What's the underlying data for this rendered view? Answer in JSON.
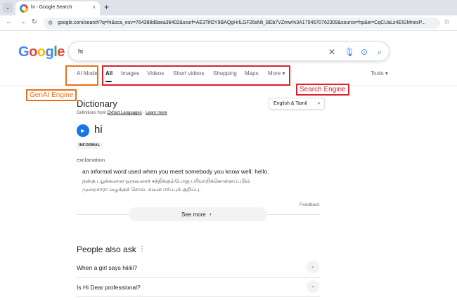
{
  "browser": {
    "tab_menu_icon": "chevron-down-icon",
    "tab_title": "hi - Google Search",
    "tab_close": "×",
    "new_tab": "+",
    "back": "←",
    "forward": "→",
    "reload": "↻",
    "site_info_icon": "tune-icon",
    "url": "google.com/search?q=hi&sca_esv=764388d8aea36402&sxsrf=AE3TifOY9BAQgHrlLGF26sNli_BEb7VZmw%3A1754570762309&source=hp&ei=CqCUaLz4EIGMnesP...",
    "star": "☆"
  },
  "google": {
    "logo_letters": [
      "G",
      "o",
      "o",
      "g",
      "l",
      "e"
    ],
    "query": "hi",
    "clear_icon": "✕",
    "mic_icon": "🎙",
    "lens_icon": "⊙",
    "search_icon": "⌕"
  },
  "tabs": {
    "ai_mode": "AI Mode",
    "all": "All",
    "images": "Images",
    "videos": "Videos",
    "short_videos": "Short videos",
    "shopping": "Shopping",
    "maps": "Maps",
    "more": "More ▾",
    "tools": "Tools ▾"
  },
  "annotations": {
    "genai_label": "GenAI Engine",
    "search_label": "Search Engine",
    "orange": "#e8711a",
    "red": "#d9232e"
  },
  "dictionary": {
    "title": "Dictionary",
    "source_prefix": "Definitions from ",
    "source_link": "Oxford Languages",
    "source_sep": " · ",
    "learn_more": "Learn more",
    "language": "English & Tamil",
    "language_caret": "▾",
    "speaker_icon": "🔊",
    "word": "hi",
    "register": "INFORMAL",
    "part_of_speech": "exclamation",
    "definition": "an informal word used when you meet somebody you know well; hello.",
    "tamil_line1": "நன்கு பழக்கமான ஒருவரைச் சந்திக்கும்போது பரிமாறிக்கொள்ளப்படும்",
    "tamil_line2": "முறைசாரா வழக்குச் சொல். கவன ஈர்ப்புக் குறிப்பு.",
    "feedback": "Feedback",
    "see_more": "See more",
    "see_more_chev": "›"
  },
  "people_also_ask": {
    "title": "People also ask",
    "menu": "⋮",
    "questions": [
      "When a girl says hiiiiii?",
      "Is Hi Dear professional?"
    ],
    "chevron": "⌄"
  }
}
